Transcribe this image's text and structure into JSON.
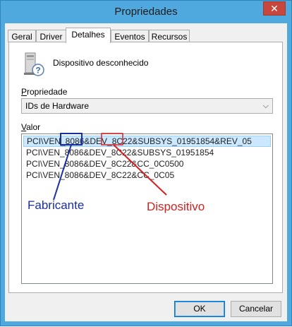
{
  "window": {
    "title": "Propriedades",
    "close_label": "✕"
  },
  "tabs": [
    {
      "label": "Geral"
    },
    {
      "label": "Driver"
    },
    {
      "label": "Detalhes",
      "active": true
    },
    {
      "label": "Eventos"
    },
    {
      "label": "Recursos"
    }
  ],
  "device": {
    "name": "Dispositivo desconhecido",
    "icon": "unknown-device-icon"
  },
  "property": {
    "label_first": "P",
    "label_rest": "ropriedade",
    "selected": "IDs de Hardware"
  },
  "value": {
    "label_first": "V",
    "label_rest": "alor",
    "items": [
      "PCI\\VEN_8086&DEV_8C22&SUBSYS_01951854&REV_05",
      "PCI\\VEN_8086&DEV_8C22&SUBSYS_01951854",
      "PCI\\VEN_8086&DEV_8C22&CC_0C0500",
      "PCI\\VEN_8086&DEV_8C22&CC_0C05"
    ]
  },
  "annotations": {
    "vendor_label": "Fabricante",
    "vendor_color": "#1a2fa0",
    "device_label": "Dispositivo",
    "device_color": "#d62020"
  },
  "buttons": {
    "ok": "OK",
    "cancel": "Cancelar"
  }
}
